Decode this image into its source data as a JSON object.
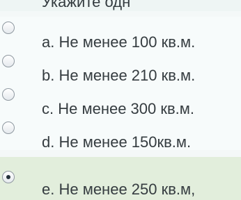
{
  "question": {
    "partial_text": "Укажите одн"
  },
  "options": [
    {
      "label": "a. Не менее 100 кв.м.",
      "selected": false
    },
    {
      "label": "b. Не менее 210 кв.м.",
      "selected": false
    },
    {
      "label": "c. Не менее 300 кв.м.",
      "selected": false
    },
    {
      "label": "d. Не менее 150кв.м.",
      "selected": false
    },
    {
      "label": "e. Не менее 250 кв.м,",
      "selected": true
    }
  ],
  "colors": {
    "background": "#f4f8f8",
    "selected_background": "#e2eedc",
    "text": "#353c40",
    "radio_border": "#8f98a0",
    "radio_dot": "#24303a"
  },
  "icons": {
    "radio_unselected": "radio-unchecked-icon",
    "radio_selected": "radio-checked-icon"
  }
}
